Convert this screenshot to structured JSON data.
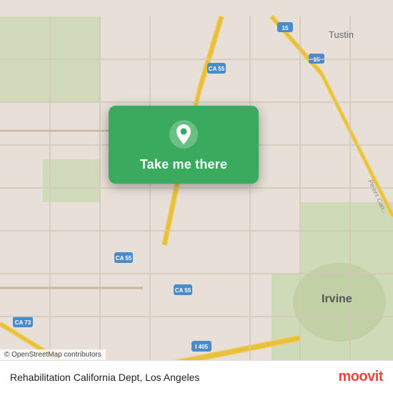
{
  "map": {
    "background_color": "#e8e0d8",
    "attribution": "© OpenStreetMap contributors"
  },
  "card": {
    "button_label": "Take me there",
    "pin_icon": "location-pin"
  },
  "bottom_bar": {
    "location_name": "Rehabilitation California Dept, Los Angeles",
    "logo_text": "moovit"
  }
}
